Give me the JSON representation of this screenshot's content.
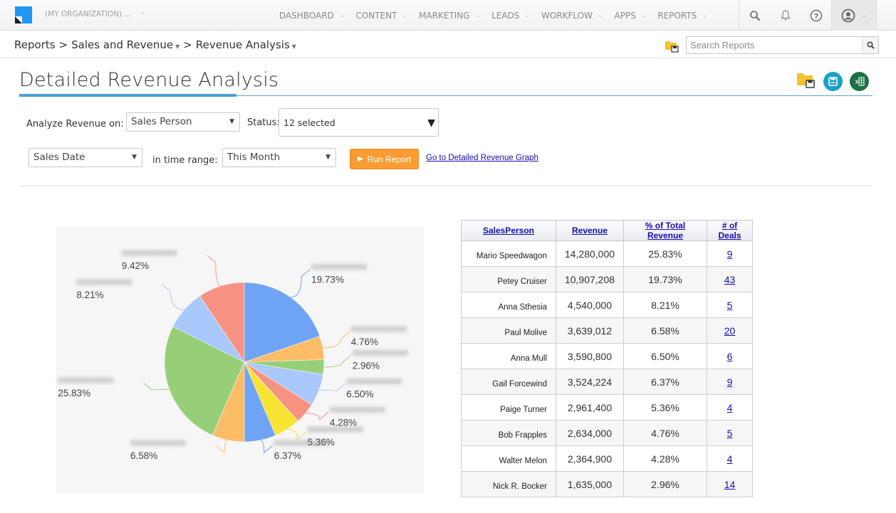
{
  "nav": {
    "org": "(MY ORGANIZATION) ...",
    "menu": [
      "DASHBOARD",
      "CONTENT",
      "MARKETING",
      "LEADS",
      "WORKFLOW",
      "APPS",
      "REPORTS"
    ],
    "icons": [
      "search-icon",
      "bell-icon",
      "help-icon",
      "user-avatar-icon"
    ]
  },
  "breadcrumb": [
    "Reports",
    ">",
    "Sales and Revenue",
    ">",
    "Revenue Analysis"
  ],
  "search": {
    "placeholder": "Search Reports"
  },
  "page": {
    "title": "Detailed Revenue Analysis"
  },
  "form": {
    "analyze_label": "Analyze Revenue on:",
    "analyze_value": "Sales Person",
    "status_label": "Status:",
    "status_value": "12 selected",
    "date_field_value": "Sales Date",
    "range_label": "in time range:",
    "range_value": "This Month",
    "run_button": "Run Report",
    "graph_link": "Go to Detailed Revenue Graph"
  },
  "colors": {
    "accent": "#4a9fd8",
    "run_button": "#f99d33",
    "link": "#1a0dab",
    "save_icon": "#1ba1c8",
    "excel_icon": "#1e7145"
  },
  "chart_data": {
    "type": "pie",
    "title": "",
    "start": "12 o'clock, clockwise",
    "slices": [
      {
        "label": "(blurred name)",
        "value": 19.73,
        "display": "19.73%",
        "color": "#6fa3f6"
      },
      {
        "label": "(blurred name)",
        "value": 4.76,
        "display": "4.76%",
        "color": "#fdbd66"
      },
      {
        "label": "(blurred name)",
        "value": 2.96,
        "display": "2.96%",
        "color": "#97cf79"
      },
      {
        "label": "(blurred name)",
        "value": 6.5,
        "display": "6.50%",
        "color": "#a9c8fb"
      },
      {
        "label": "(blurred name)",
        "value": 4.28,
        "display": "4.28%",
        "color": "#f79283"
      },
      {
        "label": "(blurred name)",
        "value": 5.36,
        "display": "5.36%",
        "color": "#f7e434"
      },
      {
        "label": "(blurred name)",
        "value": 6.37,
        "display": "6.37%",
        "color": "#6fa3f6"
      },
      {
        "label": "(blurred name)",
        "value": 6.58,
        "display": "6.58%",
        "color": "#fdbd66"
      },
      {
        "label": "(blurred name)",
        "value": 25.83,
        "display": "25.83%",
        "color": "#97cf79"
      },
      {
        "label": "(blurred name)",
        "value": 8.21,
        "display": "8.21%",
        "color": "#a9c8fb"
      },
      {
        "label": "(blurred name)",
        "value": 9.42,
        "display": "9.42%",
        "color": "#f79283"
      }
    ]
  },
  "table": {
    "headers": [
      "SalesPerson",
      "Revenue",
      "% of Total Revenue",
      "# of Deals"
    ],
    "rows": [
      [
        "Mario Speedwagon",
        "14,280,000",
        "25.83%",
        "9"
      ],
      [
        "Petey Cruiser",
        "10,907,208",
        "19.73%",
        "43"
      ],
      [
        "Anna Sthesia",
        "4,540,000",
        "8.21%",
        "5"
      ],
      [
        "Paul Molive",
        "3,639,012",
        "6.58%",
        "20"
      ],
      [
        "Anna Mull",
        "3,590,800",
        "6.50%",
        "6"
      ],
      [
        "Gail Forcewind",
        "3,524,224",
        "6.37%",
        "9"
      ],
      [
        "Paige Turner",
        "2,961,400",
        "5.36%",
        "4"
      ],
      [
        "Bob Frapples",
        "2,634,000",
        "4.76%",
        "5"
      ],
      [
        "Walter Melon",
        "2,364,900",
        "4.28%",
        "4"
      ],
      [
        "Nick R. Bocker",
        "1,635,000",
        "2.96%",
        "14"
      ]
    ]
  }
}
